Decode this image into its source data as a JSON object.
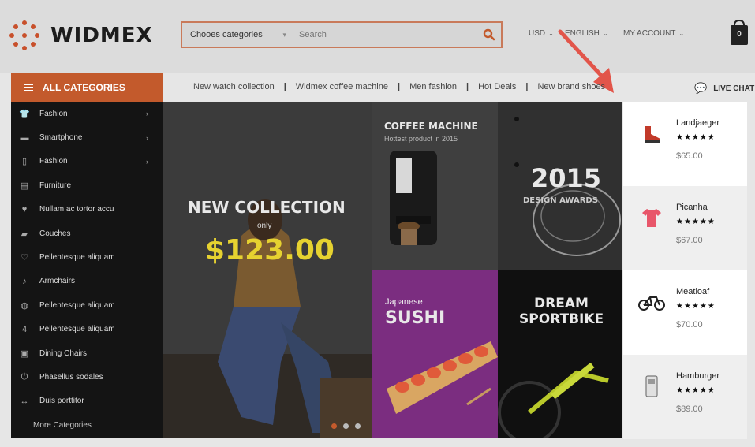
{
  "logo": {
    "text": "WIDMEX"
  },
  "search": {
    "category": "Chooes categories",
    "placeholder": "Search"
  },
  "topnav": {
    "currency": "USD",
    "language": "ENGLISH",
    "account": "MY ACCOUNT"
  },
  "cart": {
    "count": "0"
  },
  "categories": {
    "title": "ALL CATEGORIES",
    "items": [
      {
        "label": "Fashion",
        "icon": "shirt-icon",
        "arrow": true
      },
      {
        "label": "Smartphone",
        "icon": "phone-icon",
        "arrow": true
      },
      {
        "label": "Fashion",
        "icon": "mouse-icon",
        "arrow": true
      },
      {
        "label": "Furniture",
        "icon": "cabinet-icon",
        "arrow": false
      },
      {
        "label": "Nullam ac tortor accu",
        "icon": "heart-icon",
        "arrow": false
      },
      {
        "label": "Couches",
        "icon": "lamp-icon",
        "arrow": false
      },
      {
        "label": "Pellentesque aliquam",
        "icon": "heartbeat-icon",
        "arrow": false
      },
      {
        "label": "Armchairs",
        "icon": "guitar-icon",
        "arrow": false
      },
      {
        "label": "Pellentesque aliquam",
        "icon": "globe-icon",
        "arrow": false
      },
      {
        "label": "Pellentesque aliquam",
        "icon": "four-icon",
        "arrow": false
      },
      {
        "label": "Dining Chairs",
        "icon": "suitcase-icon",
        "arrow": false
      },
      {
        "label": "Phasellus sodales",
        "icon": "power-icon",
        "arrow": false
      },
      {
        "label": "Duis porttitor",
        "icon": "arrows-icon",
        "arrow": false
      }
    ],
    "more": "More Categories"
  },
  "sublinks": [
    "New watch collection",
    "Widmex coffee machine",
    "Men fashion",
    "Hot Deals",
    "New brand shoes"
  ],
  "live_chat": "LIVE CHAT",
  "banners": {
    "main": {
      "title": "NEW COLLECTION",
      "only": "only",
      "price": "$123.00"
    },
    "coffee": {
      "title": "COFFEE MACHINE",
      "subtitle": "Hottest product in 2015"
    },
    "design": {
      "year": "2015",
      "subtitle": "DESIGN AWARDS"
    },
    "sushi": {
      "small": "Japanese",
      "title": "SUSHI"
    },
    "bike": {
      "line1": "DREAM",
      "line2": "SPORTBIKE"
    }
  },
  "products": [
    {
      "name": "Landjaeger",
      "stars": "★★★★★",
      "price": "$65.00",
      "icon": "shoe-icon"
    },
    {
      "name": "Picanha",
      "stars": "★★★★★",
      "price": "$67.00",
      "icon": "tshirt-icon"
    },
    {
      "name": "Meatloaf",
      "stars": "★★★★★",
      "price": "$70.00",
      "icon": "bicycle-icon"
    },
    {
      "name": "Hamburger",
      "stars": "★★★★★",
      "price": "$89.00",
      "icon": "device-icon"
    }
  ],
  "colors": {
    "accent": "#c35a2c",
    "price_yellow": "#e6d230",
    "arrow_red": "#e2554a"
  }
}
